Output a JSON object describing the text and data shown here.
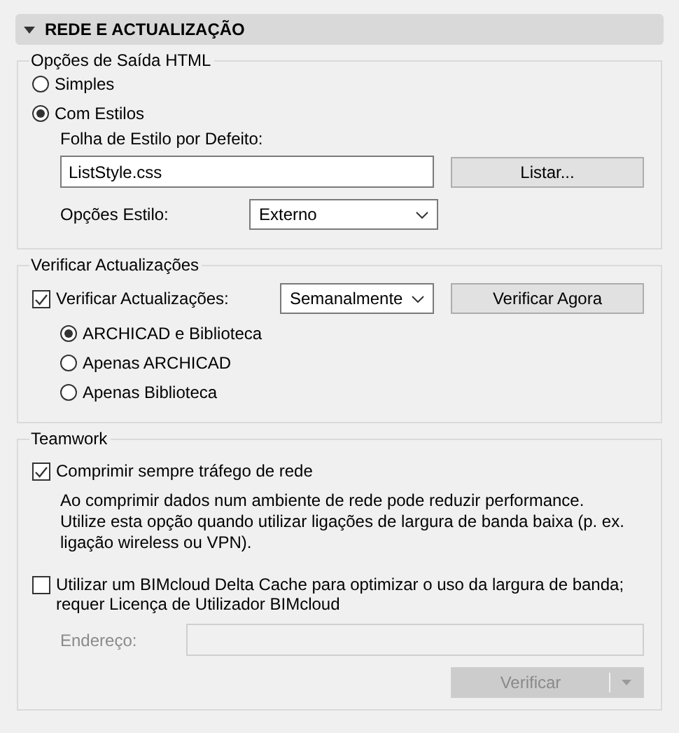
{
  "section": {
    "title": "REDE E ACTUALIZAÇÃO",
    "expanded": true
  },
  "groups": [
    {
      "title": "Opções de Saída HTML",
      "items": [
        {
          "kind": "radio",
          "label": "Simples",
          "selected": false
        },
        {
          "kind": "radio",
          "label": "Com Estilos",
          "selected": true,
          "children": [
            {
              "kind": "label",
              "text": "Folha de Estilo por Defeito:"
            },
            {
              "kind": "field-button",
              "value": "ListStyle.css",
              "button": "Listar..."
            },
            {
              "kind": "select-row",
              "label": "Opções Estilo:",
              "value": "Externo"
            }
          ]
        }
      ]
    },
    {
      "title": "Verificar Actualizações",
      "items": [
        {
          "kind": "checkbox",
          "label": "Verificar Actualizações:",
          "checked": true,
          "select": "Semanalmente",
          "button": "Verificar Agora",
          "children": [
            {
              "kind": "radio",
              "label": "ARCHICAD e Biblioteca",
              "selected": true
            },
            {
              "kind": "radio",
              "label": "Apenas ARCHICAD",
              "selected": false
            },
            {
              "kind": "radio",
              "label": "Apenas Biblioteca",
              "selected": false
            }
          ]
        }
      ]
    },
    {
      "title": "Teamwork",
      "items": [
        {
          "kind": "checkbox",
          "label": "Comprimir sempre tráfego de rede",
          "checked": true,
          "children": [
            {
              "kind": "paragraph",
              "text": "Ao comprimir dados num ambiente de rede pode reduzir performance. Utilize esta opção quando utilizar ligações de largura de banda baixa (p. ex. ligação wireless ou VPN)."
            }
          ]
        },
        {
          "kind": "checkbox",
          "label": "Utilizar um BIMcloud Delta Cache para optimizar o uso da largura de banda; requer Licença de Utilizador BIMcloud",
          "checked": false,
          "children": [
            {
              "kind": "field-row",
              "label": "Endereço:",
              "disabled": true
            },
            {
              "kind": "split-button",
              "label": "Verificar",
              "disabled": true
            }
          ]
        }
      ]
    }
  ]
}
